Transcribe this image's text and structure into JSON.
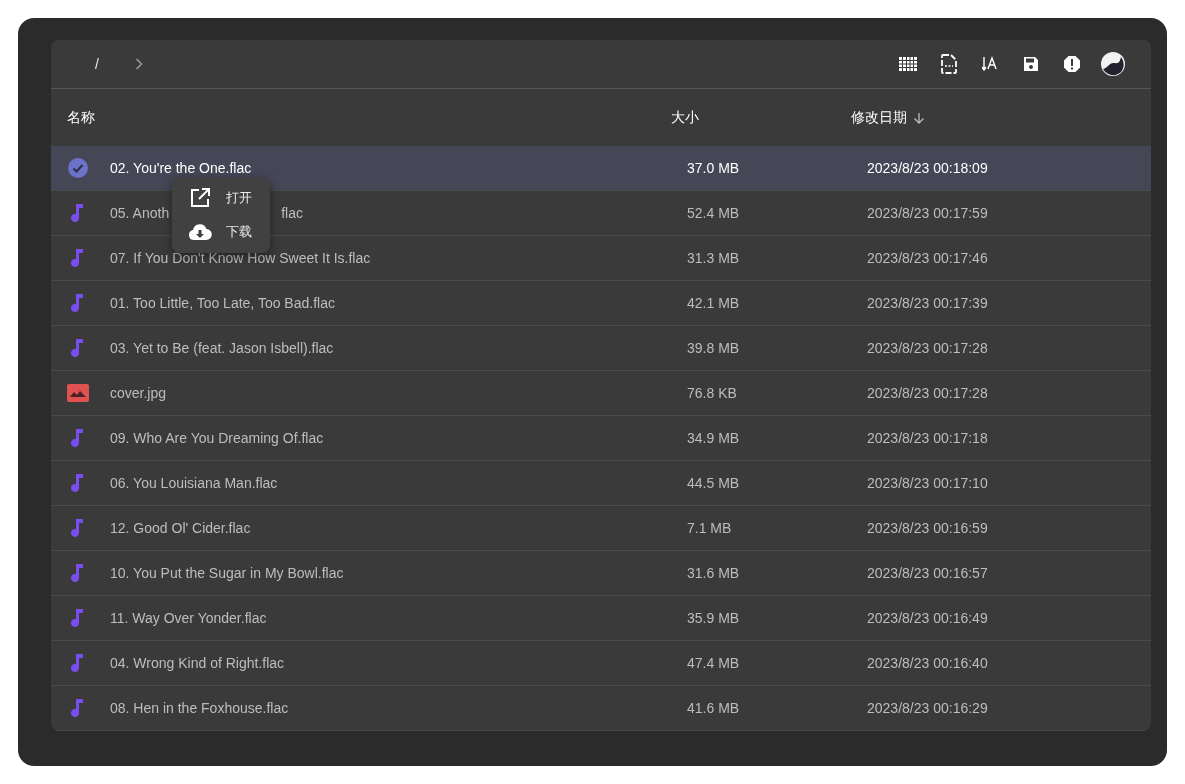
{
  "toolbar": {
    "path": "/"
  },
  "table": {
    "columns": [
      {
        "label": "名称"
      },
      {
        "label": "大小"
      },
      {
        "label": "修改日期",
        "sorted_descending": true
      }
    ],
    "rows": [
      {
        "name": "02. You're the One.flac",
        "size": "37.0 MB",
        "date": "2023/8/23 00:18:09",
        "selected": true
      },
      {
        "kind": "audio",
        "name": "05. Anoth",
        "name_tail": "flac",
        "size": "52.4 MB",
        "date": "2023/8/23 00:17:59",
        "selected": false
      },
      {
        "kind": "audio",
        "name": "07. If You Don't Know How Sweet It Is.flac",
        "size": "31.3 MB",
        "date": "2023/8/23 00:17:46",
        "selected": false
      },
      {
        "kind": "audio",
        "name": "01. Too Little, Too Late, Too Bad.flac",
        "size": "42.1 MB",
        "date": "2023/8/23 00:17:39",
        "selected": false
      },
      {
        "kind": "audio",
        "name": "03. Yet to Be (feat. Jason Isbell).flac",
        "size": "39.8 MB",
        "date": "2023/8/23 00:17:28",
        "selected": false
      },
      {
        "kind": "image",
        "name": "cover.jpg",
        "size": "76.8 KB",
        "date": "2023/8/23 00:17:28",
        "selected": false
      },
      {
        "kind": "audio",
        "name": "09. Who Are You Dreaming Of.flac",
        "size": "34.9 MB",
        "date": "2023/8/23 00:17:18",
        "selected": false
      },
      {
        "kind": "audio",
        "name": "06. You Louisiana Man.flac",
        "size": "44.5 MB",
        "date": "2023/8/23 00:17:10",
        "selected": false
      },
      {
        "kind": "audio",
        "name": "12. Good Ol' Cider.flac",
        "size": "7.1 MB",
        "date": "2023/8/23 00:16:59",
        "selected": false
      },
      {
        "kind": "audio",
        "name": "10. You Put the Sugar in My Bowl.flac",
        "size": "31.6 MB",
        "date": "2023/8/23 00:16:57",
        "selected": false
      },
      {
        "kind": "audio",
        "name": "11. Way Over Yonder.flac",
        "size": "35.9 MB",
        "date": "2023/8/23 00:16:49",
        "selected": false
      },
      {
        "kind": "audio",
        "name": "04. Wrong Kind of Right.flac",
        "size": "47.4 MB",
        "date": "2023/8/23 00:16:40",
        "selected": false
      },
      {
        "kind": "audio",
        "name": "08. Hen in the Foxhouse.flac",
        "size": "41.6 MB",
        "date": "2023/8/23 00:16:29",
        "selected": false
      }
    ]
  },
  "context_menu": {
    "items": [
      {
        "kind": "open",
        "label": "打开"
      },
      {
        "kind": "download",
        "label": "下载"
      }
    ]
  }
}
